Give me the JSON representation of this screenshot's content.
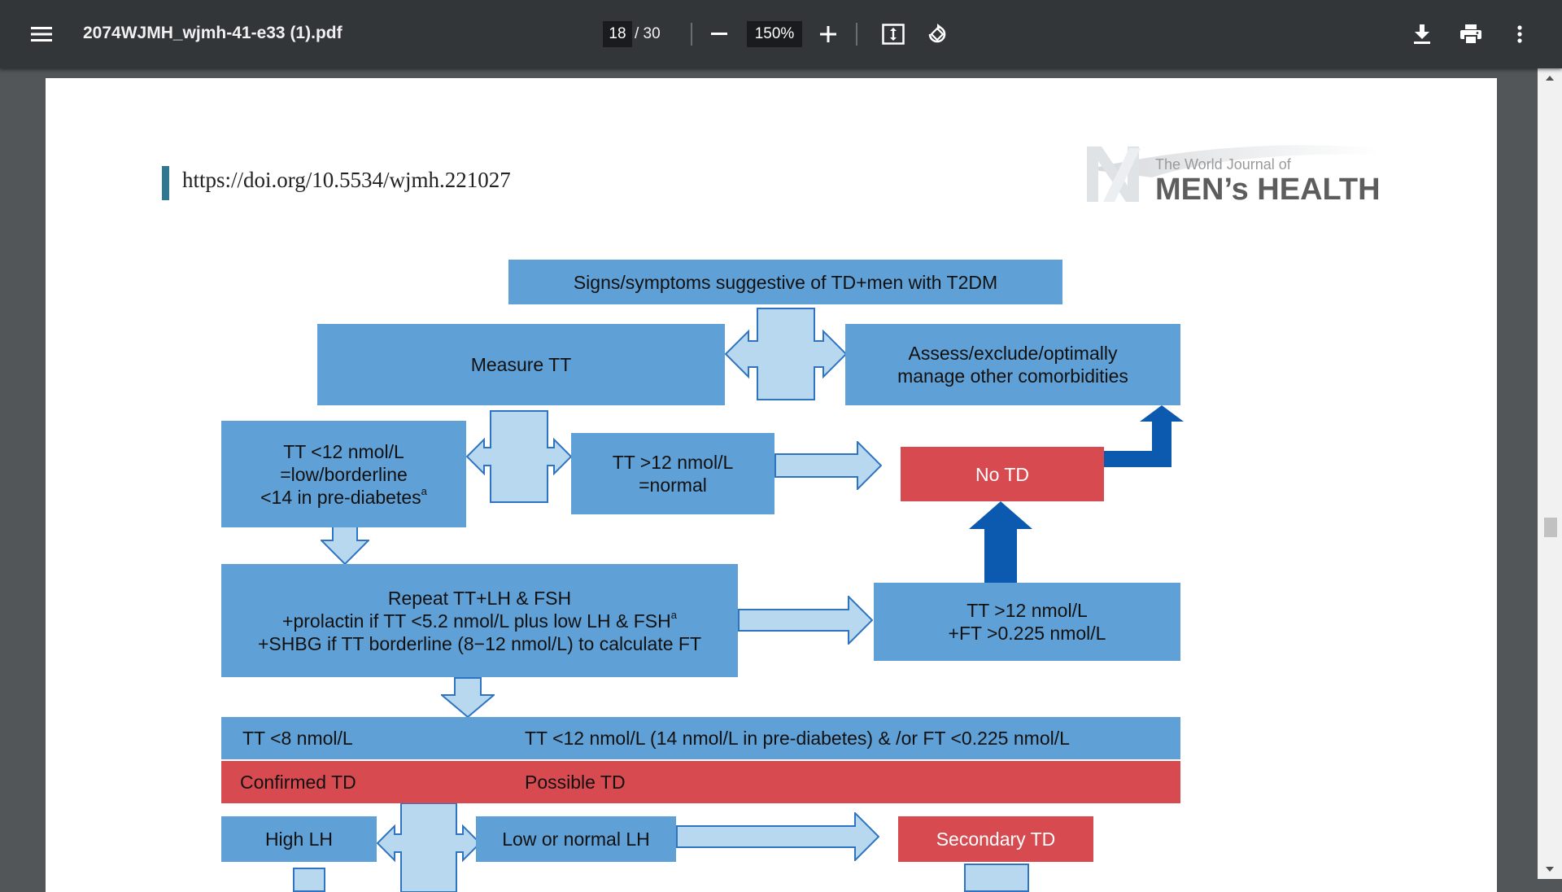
{
  "toolbar": {
    "title": "2074WJMH_wjmh-41-e33 (1).pdf",
    "page_current": "18",
    "page_total": "/ 30",
    "zoom": "150%",
    "icons": [
      "menu-icon",
      "minus-icon",
      "plus-icon",
      "fit-page-icon",
      "rotate-icon",
      "download-icon",
      "print-icon",
      "more-vert-icon"
    ]
  },
  "document": {
    "doi": "https://doi.org/10.5534/wjmh.221027",
    "logo_small": "The World Journal of",
    "logo_main": "MEN’s HEALTH"
  },
  "flowchart": {
    "signs": "Signs/symptoms suggestive of TD+men with T2DM",
    "measure_tt": "Measure TT",
    "assess_line1": "Assess/exclude/optimally",
    "assess_line2": "manage other comorbidities",
    "low_line1": "TT <12 nmol/L",
    "low_line2": "=low/borderline",
    "low_line3": "<14 in pre-diabetes",
    "low_sup": "a",
    "normal_line1": "TT >12 nmol/L",
    "normal_line2": "=normal",
    "no_td": "No TD",
    "repeat_line1": "Repeat TT+LH & FSH",
    "repeat_line2": "+prolactin if TT <5.2 nmol/L plus low LH & FSH",
    "repeat_sup": "a",
    "repeat_line3": "+SHBG if TT borderline (8−12 nmol/L) to calculate FT",
    "ft_line1": "TT >12 nmol/L",
    "ft_line2": "+FT >0.225 nmol/L",
    "tt8": "TT <8 nmol/L",
    "tt12": "TT <12 nmol/L (14 nmol/L in pre-diabetes) & /or FT <0.225 nmol/L",
    "confirmed": "Confirmed TD",
    "possible": "Possible TD",
    "high_lh": "High LH",
    "low_lh": "Low or normal LH",
    "secondary": "Secondary TD"
  },
  "colors": {
    "box_blue": "#5fa0d6",
    "arrow_light": "#b8d8f0",
    "arrow_dark": "#0b5ab0",
    "alert_red": "#d74a4f"
  }
}
